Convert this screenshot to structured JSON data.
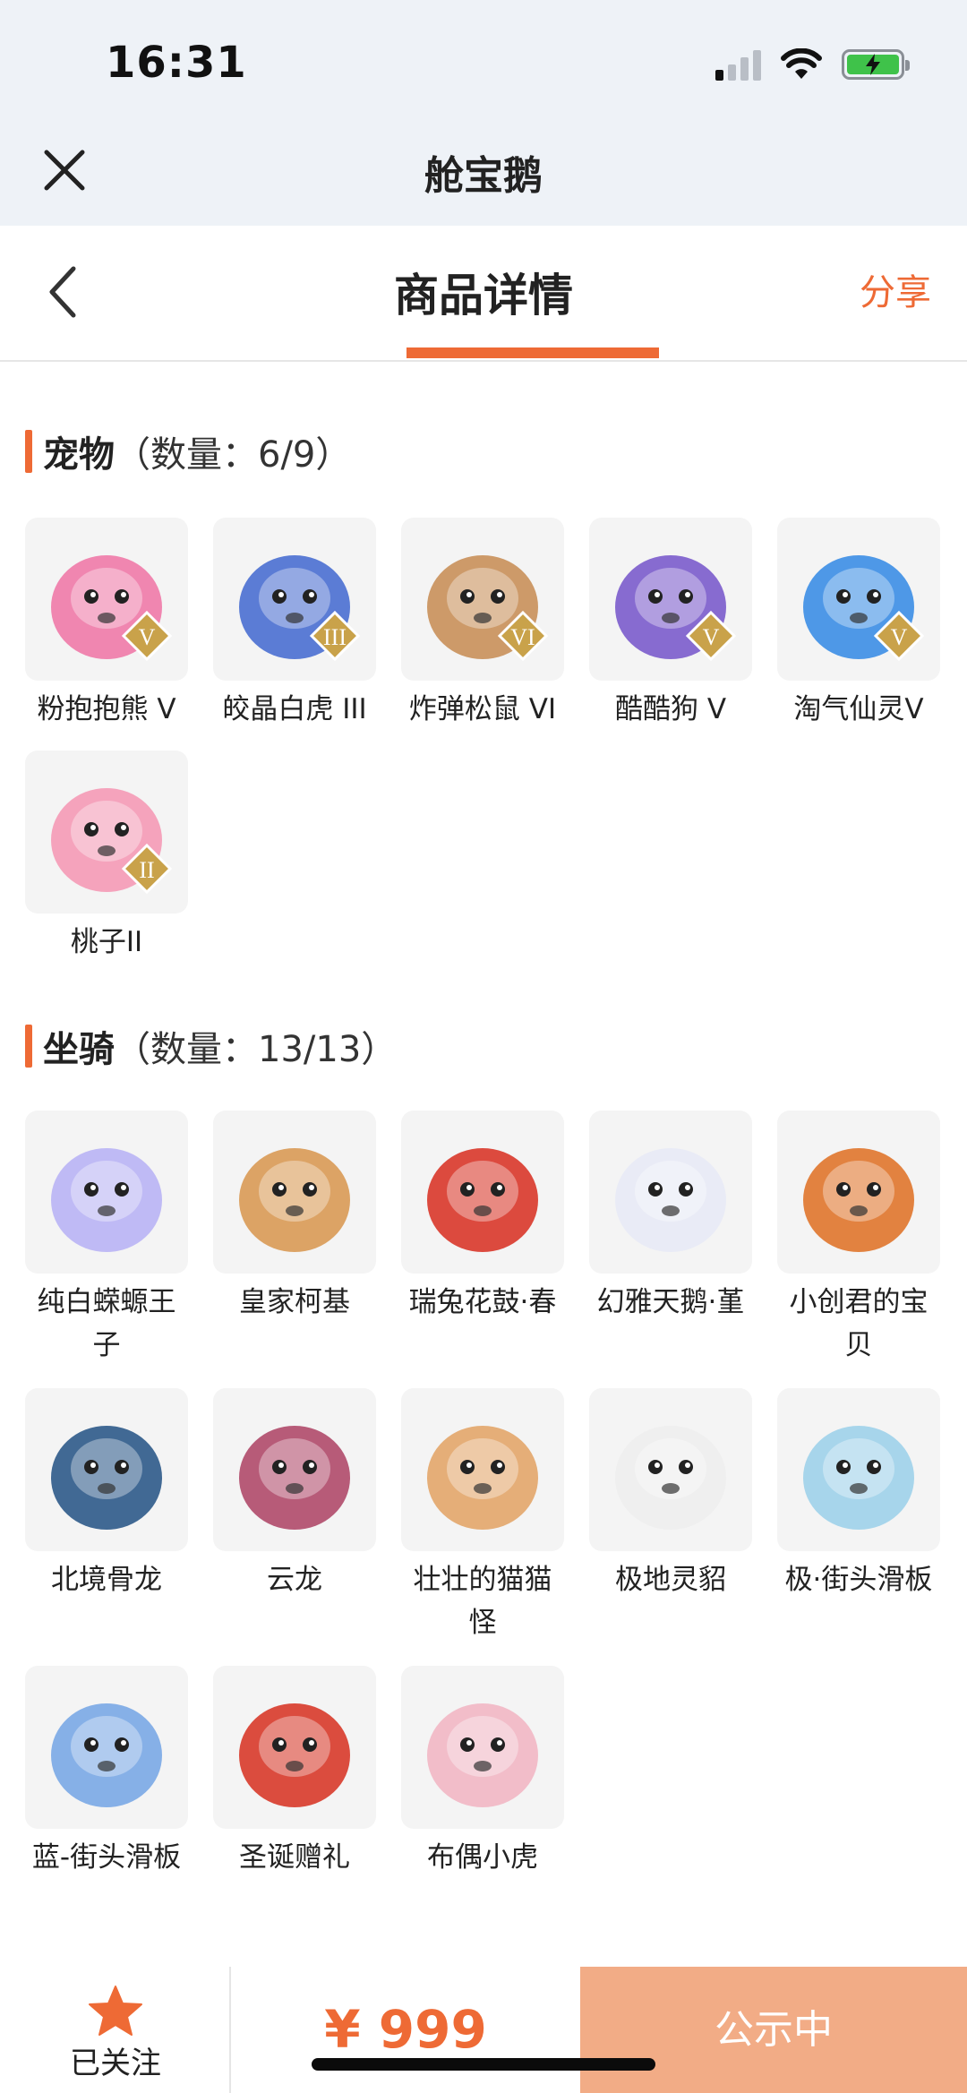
{
  "status_bar": {
    "time": "16:31"
  },
  "app": {
    "title": "舱宝鹅"
  },
  "header": {
    "title": "商品详情",
    "share_label": "分享"
  },
  "pets": {
    "name": "宠物",
    "count": "（数量：6/9）",
    "items": [
      {
        "name": "粉抱抱熊 V",
        "badge": "V",
        "icon": "pink-bear-pet-icon",
        "color": "#f07aa8"
      },
      {
        "name": "皎晶白虎 III",
        "badge": "III",
        "icon": "crystal-white-tiger-pet-icon",
        "color": "#4a6fd1"
      },
      {
        "name": "炸弹松鼠 VI",
        "badge": "VI",
        "icon": "bomb-squirrel-pet-icon",
        "color": "#c9905a"
      },
      {
        "name": "酷酷狗 V",
        "badge": "V",
        "icon": "cool-dog-pet-icon",
        "color": "#7b5ccc"
      },
      {
        "name": "淘气仙灵V",
        "badge": "V",
        "icon": "naughty-fairy-pet-icon",
        "color": "#3c8ee6"
      },
      {
        "name": "桃子II",
        "badge": "II",
        "icon": "peach-pet-icon",
        "color": "#f59ab6"
      }
    ]
  },
  "mounts": {
    "name": "坐骑",
    "count": "（数量：13/13）",
    "items": [
      {
        "name": "纯白蝾螈王子",
        "icon": "white-axolotl-prince-mount-icon",
        "color": "#b9b4f5"
      },
      {
        "name": "皇家柯基",
        "icon": "royal-corgi-mount-icon",
        "color": "#d99a55"
      },
      {
        "name": "瑞兔花鼓·春",
        "icon": "rabbit-drum-mount-icon",
        "color": "#d9372a"
      },
      {
        "name": "幻雅天鹅·堇",
        "icon": "swan-mount-icon",
        "color": "#e8eaf6"
      },
      {
        "name": "小创君的宝贝",
        "icon": "phoenix-mount-icon",
        "color": "#e0762c"
      },
      {
        "name": "北境骨龙",
        "icon": "bone-dragon-mount-icon",
        "color": "#2d5a8a"
      },
      {
        "name": "云龙",
        "icon": "cloud-dragon-mount-icon",
        "color": "#b04a6a"
      },
      {
        "name": "壮壮的猫猫怪",
        "icon": "cat-monster-mount-icon",
        "color": "#e3a66a"
      },
      {
        "name": "极地灵貂",
        "icon": "polar-mink-mount-icon",
        "color": "#eeeeee"
      },
      {
        "name": "极·街头滑板",
        "icon": "street-skateboard-mount-icon",
        "color": "#9fd1ea"
      },
      {
        "name": "蓝-街头滑板",
        "icon": "blue-skateboard-mount-icon",
        "color": "#7aa8e6"
      },
      {
        "name": "圣诞赠礼",
        "icon": "christmas-gift-mount-icon",
        "color": "#d83a2a"
      },
      {
        "name": "布偶小虎",
        "icon": "rag-doll-tiger-mount-icon",
        "color": "#f2b7c4"
      }
    ]
  },
  "bottom": {
    "follow_label": "已关注",
    "price": "¥ 999",
    "status_label": "公示中"
  }
}
